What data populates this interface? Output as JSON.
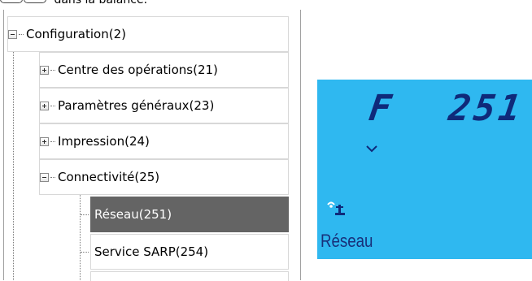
{
  "caption": {
    "text": "dans la balance."
  },
  "tree": {
    "items": [
      {
        "label": "Configuration(2)",
        "expander": "minus"
      },
      {
        "label": "Centre des opérations(21)",
        "expander": "plus"
      },
      {
        "label": "Paramètres généraux(23)",
        "expander": "plus"
      },
      {
        "label": "Impression(24)",
        "expander": "plus"
      },
      {
        "label": "Connectivité(25)",
        "expander": "minus"
      },
      {
        "label": "Réseau(251)",
        "selected": true
      },
      {
        "label": "Service SARP(254)"
      }
    ]
  },
  "lcd": {
    "code_letter": "F",
    "code_number": "251",
    "bottom_label": "Réseau",
    "icons": [
      "wifi-scale-icon",
      "small-arrow-icon"
    ],
    "background_color": "#2fb8f0"
  }
}
